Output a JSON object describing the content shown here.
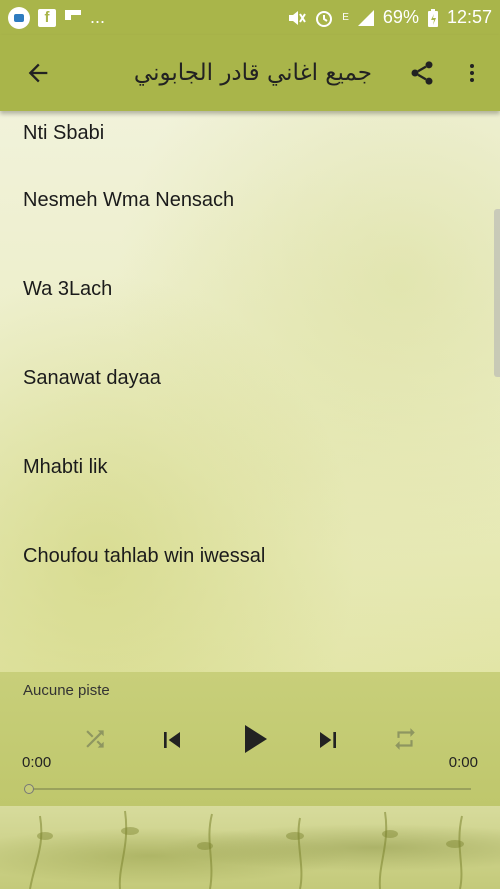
{
  "status_bar": {
    "battery": "69%",
    "time": "12:57",
    "ellipsis": "..."
  },
  "toolbar": {
    "title": "جميع اغاني قادر الجابوني",
    "icons": [
      "back-arrow-icon",
      "share-icon",
      "more-vert-icon"
    ]
  },
  "songs": [
    "Nti Sbabi",
    "Nesmeh Wma Nensach",
    "Wa 3Lach",
    "Sanawat dayaa",
    "Mhabti lik",
    "Choufou tahlab win iwessal"
  ],
  "player": {
    "track": "Aucune piste",
    "elapsed": "0:00",
    "duration": "0:00",
    "progress": 0
  },
  "colors": {
    "accent": "#a9b54a",
    "player": "#c4cb72"
  }
}
